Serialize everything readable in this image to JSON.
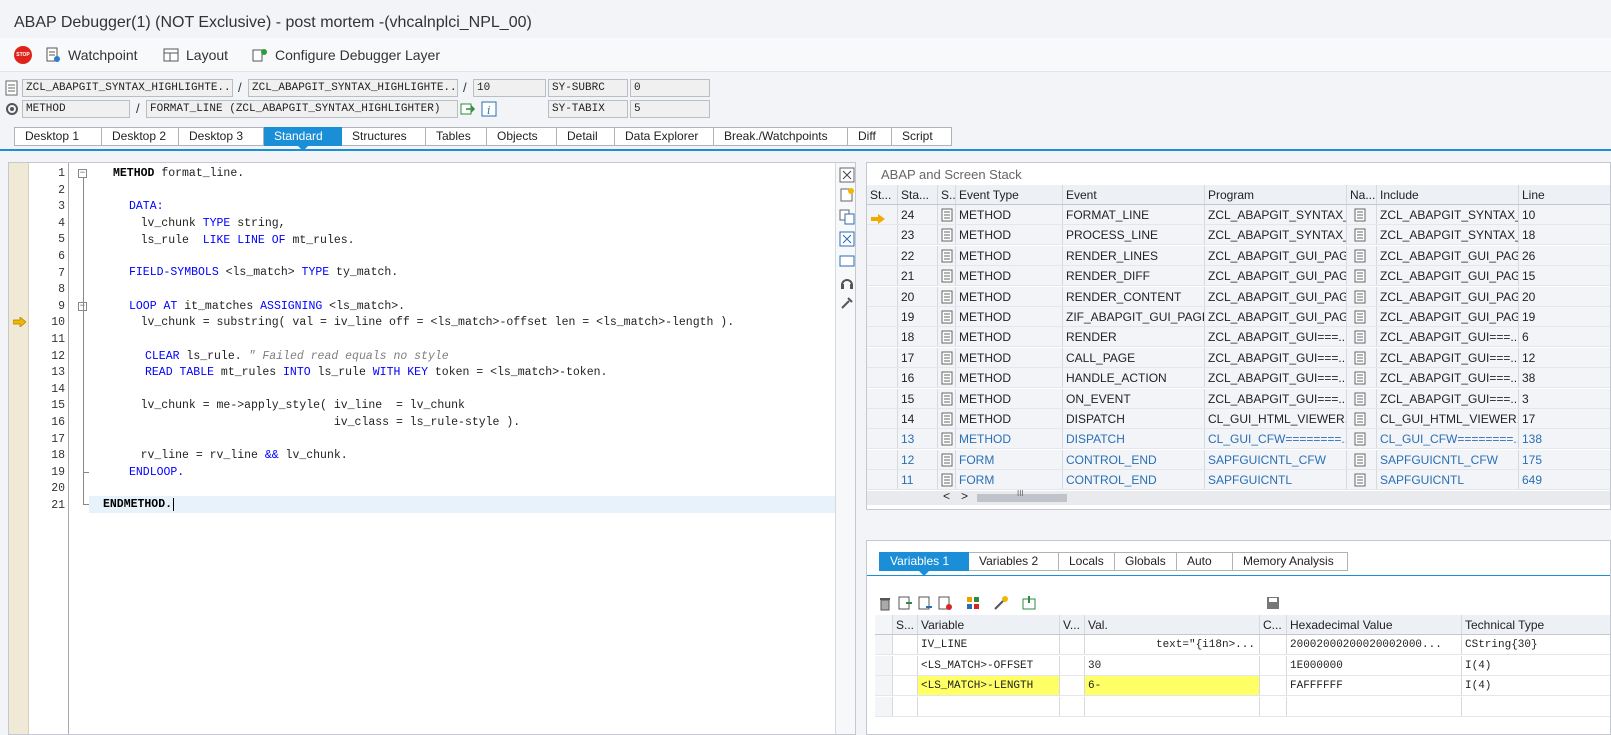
{
  "window": {
    "title": "ABAP Debugger(1)  (NOT Exclusive) - post mortem -(vhcalnplci_NPL_00)"
  },
  "toolbar": {
    "items": [
      {
        "label": "Watchpoint",
        "icon": "watchpoint-icon"
      },
      {
        "label": "Layout",
        "icon": "layout-icon"
      },
      {
        "label": "Configure Debugger Layer",
        "icon": "configure-layer-icon"
      }
    ],
    "stop_icon_text": "STOP"
  },
  "fields": {
    "program": "ZCL_ABAPGIT_SYNTAX_HIGHLIGHTE...",
    "include": "ZCL_ABAPGIT_SYNTAX_HIGHLIGHTE...",
    "line": "10",
    "sy_subrc_label": "SY-SUBRC",
    "sy_subrc_value": "0",
    "event_type": "METHOD",
    "event": "FORMAT_LINE (ZCL_ABAPGIT_SYNTAX_HIGHLIGHTER)",
    "sy_tabix_label": "SY-TABIX",
    "sy_tabix_value": "5",
    "slash": "/"
  },
  "tabs": [
    "Desktop 1",
    "Desktop 2",
    "Desktop 3",
    "Standard",
    "Structures",
    "Tables",
    "Objects",
    "Detail",
    "Data Explorer",
    "Break./Watchpoints",
    "Diff",
    "Script"
  ],
  "active_tab": "Standard",
  "editor": {
    "line_numbers": [
      "1",
      "2",
      "3",
      "4",
      "5",
      "6",
      "7",
      "8",
      "9",
      "10",
      "11",
      "12",
      "13",
      "14",
      "15",
      "16",
      "17",
      "18",
      "19",
      "20",
      "21"
    ],
    "current_line": 10,
    "code": {
      "l1a": "METHOD",
      "l1b": " format_line.",
      "l3": "DATA:",
      "l4a": "    lv_chunk ",
      "l4b": "TYPE",
      "l4c": " string,",
      "l5a": "    ls_rule  ",
      "l5b": "LIKE LINE OF",
      "l5c": " mt_rules.",
      "l7a": "FIELD-SYMBOLS",
      "l7b": " <ls_match> ",
      "l7c": "TYPE",
      "l7d": " ty_match.",
      "l9a": "LOOP AT",
      "l9b": " it_matches ",
      "l9c": "ASSIGNING",
      "l9d": " <ls_match>.",
      "l10": "    lv_chunk = substring( val = iv_line off = <ls_match>-offset len = <ls_match>-length ).",
      "l12a": "CLEAR",
      "l12b": " ls_rule. ",
      "l12c": "\" Failed read equals no style",
      "l13a": "READ TABLE",
      "l13b": " mt_rules ",
      "l13c": "INTO",
      "l13d": " ls_rule ",
      "l13e": "WITH KEY",
      "l13f": " token = <ls_match>-token.",
      "l15": "    lv_chunk = me->apply_style( iv_line  = lv_chunk",
      "l16": "                                iv_class = ls_rule-style ).",
      "l18a": "    rv_line = rv_line ",
      "l18b": "&&",
      "l18c": " lv_chunk.",
      "l19": "ENDLOOP.",
      "l21": "ENDMETHOD."
    }
  },
  "stack": {
    "title": "ABAP and Screen Stack",
    "columns": [
      "St...",
      "Sta...",
      "S...",
      "Event Type",
      "Event",
      "Program",
      "Na...",
      "Include",
      "Line"
    ],
    "rows": [
      {
        "current": true,
        "level": "24",
        "type": "METHOD",
        "event": "FORMAT_LINE",
        "program": "ZCL_ABAPGIT_SYNTAX_...",
        "include": "ZCL_ABAPGIT_SYNTAX_...",
        "line": "10",
        "blue": false
      },
      {
        "current": false,
        "level": "23",
        "type": "METHOD",
        "event": "PROCESS_LINE",
        "program": "ZCL_ABAPGIT_SYNTAX_...",
        "include": "ZCL_ABAPGIT_SYNTAX_...",
        "line": "18",
        "blue": false
      },
      {
        "current": false,
        "level": "22",
        "type": "METHOD",
        "event": "RENDER_LINES",
        "program": "ZCL_ABAPGIT_GUI_PAG...",
        "include": "ZCL_ABAPGIT_GUI_PAG...",
        "line": "26",
        "blue": false
      },
      {
        "current": false,
        "level": "21",
        "type": "METHOD",
        "event": "RENDER_DIFF",
        "program": "ZCL_ABAPGIT_GUI_PAG...",
        "include": "ZCL_ABAPGIT_GUI_PAG...",
        "line": "15",
        "blue": false
      },
      {
        "current": false,
        "level": "20",
        "type": "METHOD",
        "event": "RENDER_CONTENT",
        "program": "ZCL_ABAPGIT_GUI_PAG...",
        "include": "ZCL_ABAPGIT_GUI_PAG...",
        "line": "20",
        "blue": false
      },
      {
        "current": false,
        "level": "19",
        "type": "METHOD",
        "event": "ZIF_ABAPGIT_GUI_PAGE...",
        "program": "ZCL_ABAPGIT_GUI_PAG...",
        "include": "ZCL_ABAPGIT_GUI_PAG...",
        "line": "19",
        "blue": false
      },
      {
        "current": false,
        "level": "18",
        "type": "METHOD",
        "event": "RENDER",
        "program": "ZCL_ABAPGIT_GUI===...",
        "include": "ZCL_ABAPGIT_GUI===...",
        "line": "6",
        "blue": false
      },
      {
        "current": false,
        "level": "17",
        "type": "METHOD",
        "event": "CALL_PAGE",
        "program": "ZCL_ABAPGIT_GUI===...",
        "include": "ZCL_ABAPGIT_GUI===...",
        "line": "12",
        "blue": false
      },
      {
        "current": false,
        "level": "16",
        "type": "METHOD",
        "event": "HANDLE_ACTION",
        "program": "ZCL_ABAPGIT_GUI===...",
        "include": "ZCL_ABAPGIT_GUI===...",
        "line": "38",
        "blue": false
      },
      {
        "current": false,
        "level": "15",
        "type": "METHOD",
        "event": "ON_EVENT",
        "program": "ZCL_ABAPGIT_GUI===...",
        "include": "ZCL_ABAPGIT_GUI===...",
        "line": "3",
        "blue": false
      },
      {
        "current": false,
        "level": "14",
        "type": "METHOD",
        "event": "DISPATCH",
        "program": "CL_GUI_HTML_VIEWER...",
        "include": "CL_GUI_HTML_VIEWER...",
        "line": "17",
        "blue": false
      },
      {
        "current": false,
        "level": "13",
        "type": "METHOD",
        "event": "DISPATCH",
        "program": "CL_GUI_CFW========...",
        "include": "CL_GUI_CFW========...",
        "line": "138",
        "blue": true
      },
      {
        "current": false,
        "level": "12",
        "type": "FORM",
        "event": "CONTROL_END",
        "program": "SAPFGUICNTL_CFW",
        "include": "SAPFGUICNTL_CFW",
        "line": "175",
        "blue": true
      },
      {
        "current": false,
        "level": "11",
        "type": "FORM",
        "event": "CONTROL_END",
        "program": "SAPFGUICNTL",
        "include": "SAPFGUICNTL",
        "line": "649",
        "blue": true
      }
    ],
    "scroll_arrows": [
      "<",
      ">"
    ],
    "scroll_thumb_text": "III"
  },
  "variables": {
    "tabs": [
      "Variables 1",
      "Variables 2",
      "Locals",
      "Globals",
      "Auto",
      "Memory Analysis"
    ],
    "active_tab": "Variables 1",
    "columns": [
      "S...",
      "Variable",
      "V...",
      "Val.",
      "C...",
      "Hexadecimal Value",
      "Technical Type"
    ],
    "rows": [
      {
        "variable": "IV_LINE",
        "value": "text=\"{i18n>...",
        "hex": "20002000200020002000...",
        "type": "CString{30}",
        "highlight": false
      },
      {
        "variable": "<LS_MATCH>-OFFSET",
        "value": "30",
        "hex": "1E000000",
        "type": "I(4)",
        "highlight": false
      },
      {
        "variable": "<LS_MATCH>-LENGTH",
        "value": "6-",
        "hex": "FAFFFFFF",
        "type": "I(4)",
        "highlight": true
      }
    ]
  },
  "colors": {
    "accent": "#1a8fd7",
    "highlight": "#ffff66",
    "keyword": "#0000ff"
  }
}
